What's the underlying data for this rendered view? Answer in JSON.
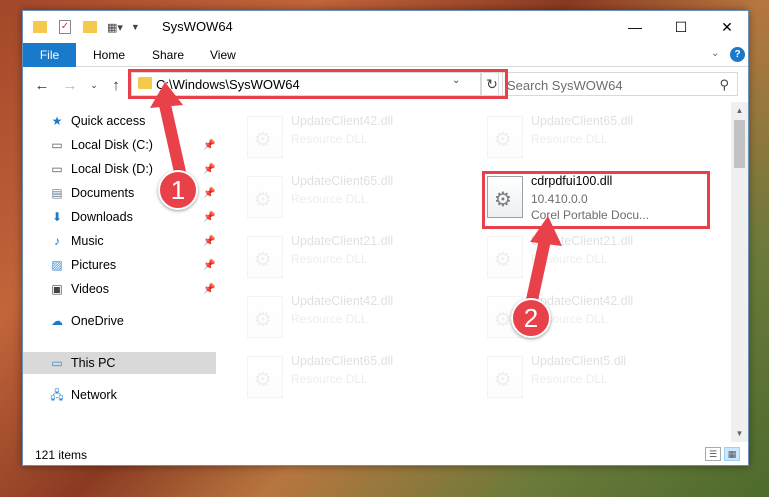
{
  "window": {
    "title": "SysWOW64",
    "controls": {
      "minimize": "—",
      "maximize": "☐",
      "close": "✕"
    }
  },
  "ribbon": {
    "tabs": [
      {
        "label": "File"
      },
      {
        "label": "Home"
      },
      {
        "label": "Share"
      },
      {
        "label": "View"
      }
    ]
  },
  "nav": {
    "address": "C:\\Windows\\SysWOW64",
    "search_placeholder": "Search SysWOW64"
  },
  "sidebar": {
    "items": [
      {
        "label": "Quick access",
        "icon": "star-icon"
      },
      {
        "label": "Local Disk (C:)",
        "icon": "drive-icon",
        "pinned": true
      },
      {
        "label": "Local Disk (D:)",
        "icon": "drive-icon",
        "pinned": true
      },
      {
        "label": "Documents",
        "icon": "documents-icon",
        "pinned": true
      },
      {
        "label": "Downloads",
        "icon": "downloads-icon",
        "pinned": true
      },
      {
        "label": "Music",
        "icon": "music-icon",
        "pinned": true
      },
      {
        "label": "Pictures",
        "icon": "pictures-icon",
        "pinned": true
      },
      {
        "label": "Videos",
        "icon": "videos-icon",
        "pinned": true
      },
      {
        "label": "OneDrive",
        "icon": "cloud-icon"
      },
      {
        "label": "This PC",
        "icon": "computer-icon",
        "selected": true
      },
      {
        "label": "Network",
        "icon": "network-icon"
      }
    ]
  },
  "files": [
    {
      "name": "UpdateClient42.dll",
      "type": "Resource DLL"
    },
    {
      "name": "UpdateClient65.dll",
      "type": "Resource DLL"
    },
    {
      "name": "UpdateClient65.dll",
      "type": "Resource DLL"
    },
    {
      "name": "cdrpdfui100.dll",
      "version": "10.410.0.0",
      "description": "Corel Portable Docu...",
      "active": true
    },
    {
      "name": "UpdateClient21.dll",
      "type": "Resource DLL"
    },
    {
      "name": "UpdateClient21.dll",
      "type": "Resource DLL"
    },
    {
      "name": "UpdateClient42.dll",
      "type": "Resource DLL"
    },
    {
      "name": "UpdateClient42.dll",
      "type": "Resource DLL"
    },
    {
      "name": "UpdateClient65.dll",
      "type": "Resource DLL"
    },
    {
      "name": "UpdateClient5.dll",
      "type": "Resource DLL"
    }
  ],
  "status": {
    "item_count": "121 items"
  },
  "annotations": {
    "badge1": "1",
    "badge2": "2",
    "highlight_color": "#e8414a"
  }
}
